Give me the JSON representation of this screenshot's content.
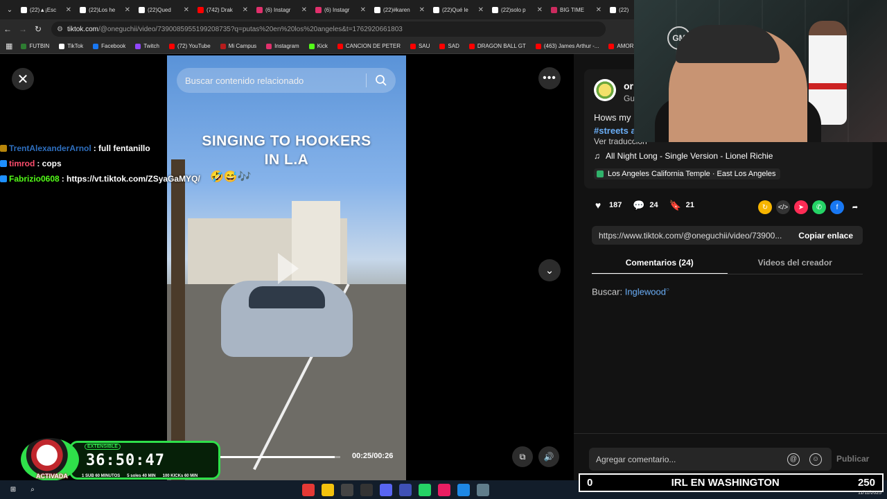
{
  "browser": {
    "tabs": [
      {
        "title": "(22)▲¡Esc",
        "color": "#ffffff"
      },
      {
        "title": "(22)Los he",
        "color": "#ffffff"
      },
      {
        "title": "(22)Qued",
        "color": "#ffffff"
      },
      {
        "title": "(742) Drak",
        "color": "#ff0000"
      },
      {
        "title": "(6) Instagr",
        "color": "#e1306c"
      },
      {
        "title": "(6) Instagr",
        "color": "#e1306c"
      },
      {
        "title": "(22)#karen",
        "color": "#ffffff"
      },
      {
        "title": "(22)Qué le",
        "color": "#ffffff"
      },
      {
        "title": "(22)solo p",
        "color": "#ffffff"
      },
      {
        "title": "BIG TIME",
        "color": "#cc2b5e"
      },
      {
        "title": "(22)",
        "color": "#ffffff"
      }
    ],
    "url_host": "tiktok.com",
    "url_rest": "/@oneguchii/video/7390085955199208735?q=putas%20en%20los%20angeles&t=1762920661803",
    "bookmarks": [
      {
        "label": "FUTBIN",
        "color": "#2e7d32"
      },
      {
        "label": "TikTok",
        "color": "#ffffff"
      },
      {
        "label": "Facebook",
        "color": "#1877f2"
      },
      {
        "label": "Twitch",
        "color": "#9146ff"
      },
      {
        "label": "(72) YouTube",
        "color": "#ff0000"
      },
      {
        "label": "Mi Campus",
        "color": "#b71c1c"
      },
      {
        "label": "Instagram",
        "color": "#e1306c"
      },
      {
        "label": "Kick",
        "color": "#53fc18"
      },
      {
        "label": "CANCION DE PETER",
        "color": "#ff0000"
      },
      {
        "label": "SAU",
        "color": "#ff0000"
      },
      {
        "label": "SAD",
        "color": "#ff0000"
      },
      {
        "label": "DRAGON BALL GT",
        "color": "#ff0000"
      },
      {
        "label": "(463) James Arthur -...",
        "color": "#ff0000"
      },
      {
        "label": "AMOR",
        "color": "#ff0000"
      }
    ]
  },
  "video": {
    "search_placeholder": "Buscar contenido relacionado",
    "title_line1": "SINGING TO HOOKERS",
    "title_line2": "IN L.A",
    "time": "00:25/00:26",
    "progress": 0.96
  },
  "chat": [
    {
      "user": "TrentAlexanderArnol",
      "msg": ": full fentanillo",
      "color": "#2e6fbf",
      "badge": "#b8860b"
    },
    {
      "user": "timrod",
      "msg": ": cops",
      "color": "#ff4d6d",
      "badge": "#1e90ff"
    },
    {
      "user": "Fabrizio0608",
      "msg": ": https://vt.tiktok.com/ZSyaGaMYQ/",
      "color": "#53fc18",
      "badge": "#1e90ff"
    }
  ],
  "post": {
    "username": "or",
    "subtitle": "Gu",
    "description": "Hows my",
    "hashtag": "#streets a",
    "see_translation": "Ver traducción",
    "music": "All Night Long - Single Version - Lionel Richie",
    "location": "Los Angeles California Temple · East Los Angeles",
    "likes": "187",
    "comments": "24",
    "saves": "21",
    "link": "https://www.tiktok.com/@oneguchii/video/73900...",
    "copy_label": "Copiar enlace",
    "tab_comments": "Comentarios (24)",
    "tab_creator": "Videos del creador",
    "search_prefix": "Buscar:",
    "search_term": "Inglewood",
    "comment_placeholder": "Agregar comentario...",
    "publish": "Publicar"
  },
  "overlay": {
    "timer": "36:50:47",
    "extensible": "EXTENSIBLE",
    "activated": "ACTIVADA",
    "sub_1": "1 SUB 60 MINUTOS",
    "sub_2": "5 soles 40 MIN",
    "sub_3": "100 KICKs 60 MIN",
    "goal_left": "0",
    "goal_title": "IRL EN WASHINGTON",
    "goal_right": "250",
    "webcam_logo": "GM",
    "date": "11/11/2025"
  }
}
